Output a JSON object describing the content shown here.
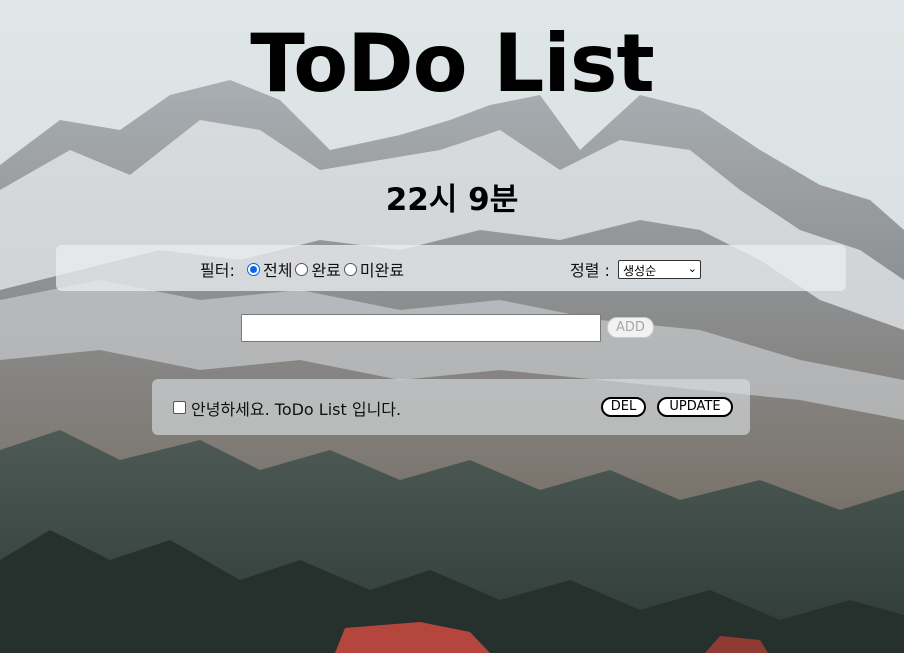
{
  "app": {
    "title": "ToDo List",
    "clock": "22시 9분"
  },
  "filter": {
    "label": "필터:",
    "options": [
      {
        "label": "전체",
        "selected": true
      },
      {
        "label": "완료",
        "selected": false
      },
      {
        "label": "미완료",
        "selected": false
      }
    ]
  },
  "sort": {
    "label": "정렬 :",
    "selected": "생성순"
  },
  "input": {
    "value": "",
    "add_label": "ADD"
  },
  "todos": [
    {
      "text": "안녕하세요. ToDo List 입니다.",
      "done": false,
      "del_label": "DEL",
      "update_label": "UPDATE"
    }
  ],
  "colors": {
    "accent": "#0b66e4"
  }
}
